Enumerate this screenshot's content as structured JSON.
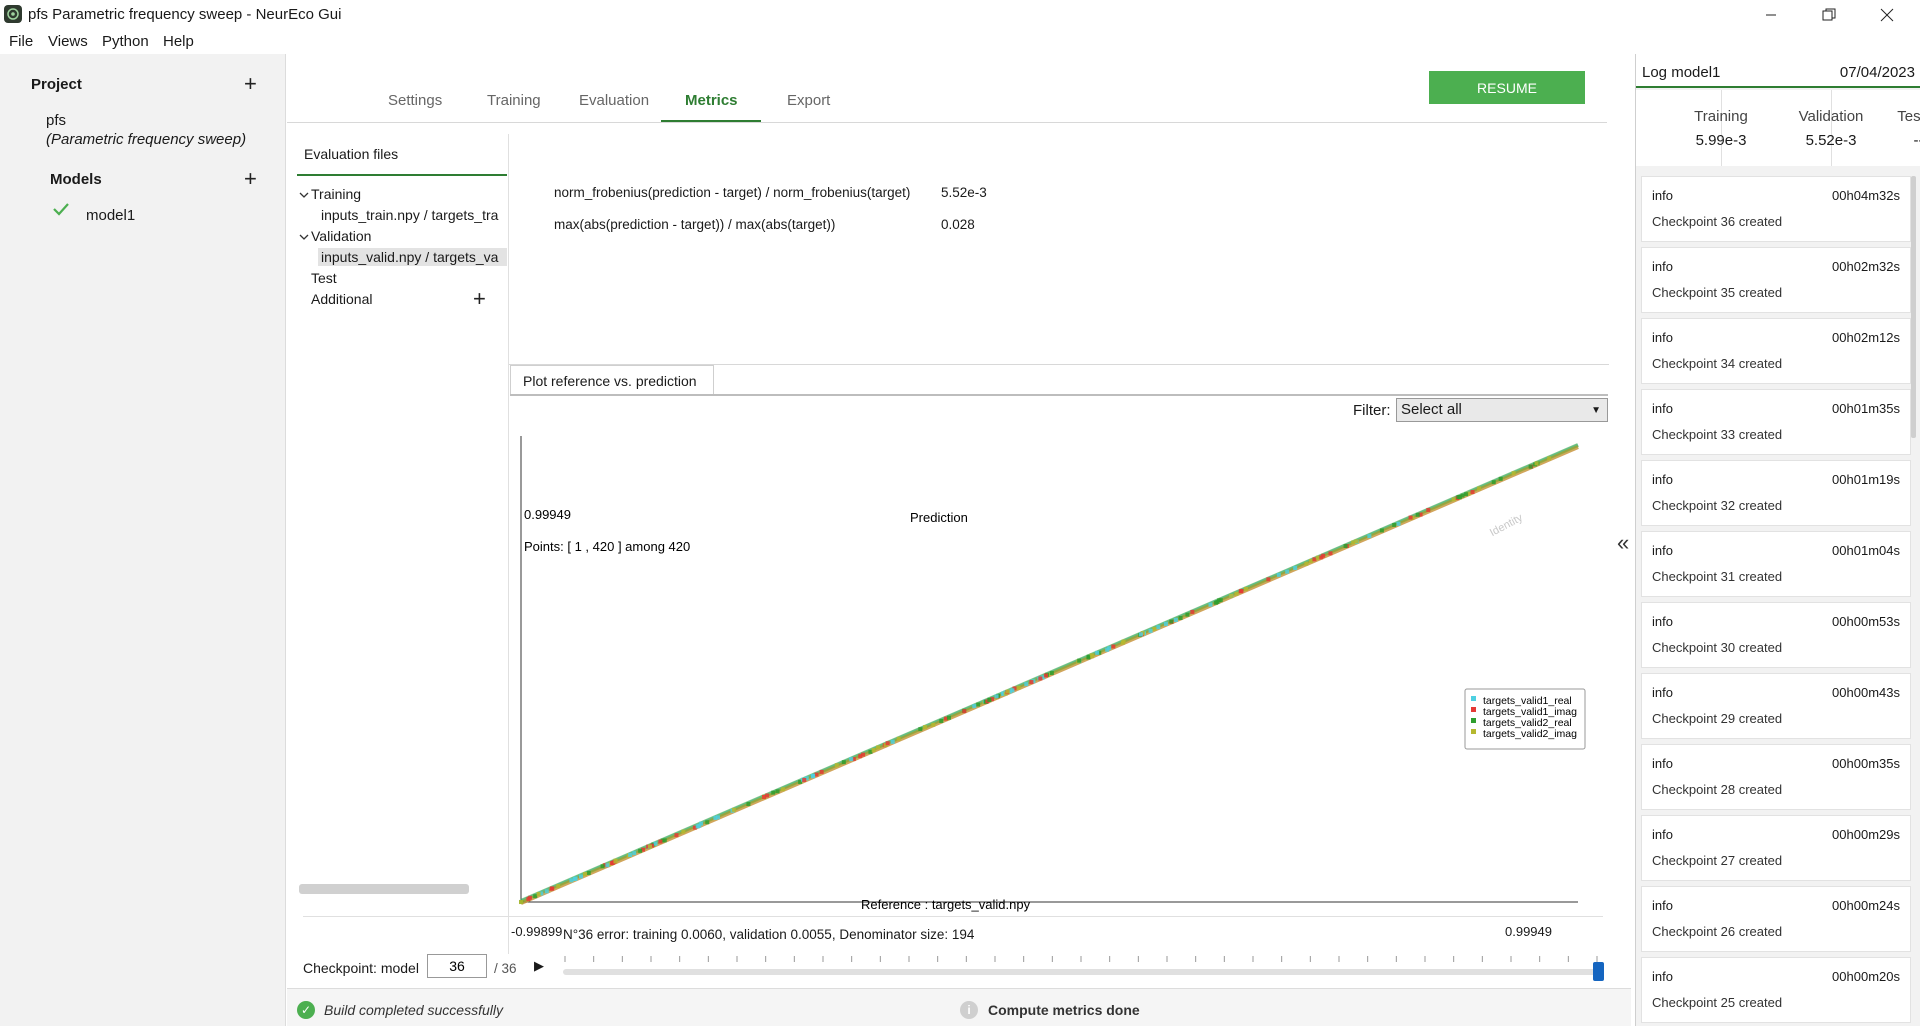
{
  "window": {
    "title": "pfs  Parametric frequency sweep  - NeurEco Gui"
  },
  "menu": [
    "File",
    "Views",
    "Python",
    "Help"
  ],
  "project": {
    "heading": "Project",
    "name": "pfs",
    "description": "(Parametric frequency sweep)",
    "models_heading": "Models",
    "models": [
      {
        "name": "model1",
        "status": "ok"
      }
    ]
  },
  "tabs": [
    "Settings",
    "Training",
    "Evaluation",
    "Metrics",
    "Export"
  ],
  "active_tab": "Metrics",
  "resume_label": "RESUME",
  "eval_files": {
    "label": "Evaluation files",
    "training": "Training",
    "training_file": "inputs_train.npy / targets_tra",
    "validation": "Validation",
    "validation_file": "inputs_valid.npy / targets_va",
    "test": "Test",
    "additional": "Additional"
  },
  "metrics": [
    {
      "name": "norm_frobenius(prediction - target) / norm_frobenius(target)",
      "value": "5.52e-3"
    },
    {
      "name": "max(abs(prediction - target)) / max(abs(target))",
      "value": "0.028"
    }
  ],
  "plot_tab": "Plot reference vs. prediction",
  "filter": {
    "label": "Filter:",
    "value": "Select all"
  },
  "colors": {
    "accent": "#2e7d32",
    "resume": "#4caf50",
    "series": [
      "#4dd0e1",
      "#e53935",
      "#2e9e2e",
      "#b5b82f"
    ]
  },
  "chart_data": {
    "type": "scatter",
    "title": "Prediction",
    "xlabel": "Reference : targets_valid.npy",
    "ymax_label": "0.99949",
    "xmin_label": "-0.99899",
    "xmax_label": "0.99949",
    "points_text": "Points: [ 1 , 420 ] among 420",
    "identity_label": "Identity",
    "xlim": [
      -0.99899,
      0.99949
    ],
    "ylim": [
      -0.99899,
      0.99949
    ],
    "series": [
      {
        "name": "targets_valid1_real"
      },
      {
        "name": "targets_valid1_imag"
      },
      {
        "name": "targets_valid2_real"
      },
      {
        "name": "targets_valid2_imag"
      }
    ],
    "legend_position": "bottom-right"
  },
  "error_text": "N°36 error: training 0.0060, validation 0.0055, Denominator size: 194",
  "checkpoint": {
    "label": "Checkpoint: model",
    "value": "36",
    "total": "/ 36",
    "position": 36,
    "max": 36
  },
  "status": {
    "build": "Build completed successfully",
    "compute": "Compute metrics done"
  },
  "log": {
    "title": "Log model1",
    "date": "07/04/2023",
    "metrics": [
      {
        "label": "Training",
        "value": "5.99e-3"
      },
      {
        "label": "Validation",
        "value": "5.52e-3"
      },
      {
        "label": "Testing",
        "value": "---"
      }
    ],
    "entries": [
      {
        "level": "info",
        "time": "00h04m32s",
        "message": "Checkpoint 36 created"
      },
      {
        "level": "info",
        "time": "00h02m32s",
        "message": "Checkpoint 35 created"
      },
      {
        "level": "info",
        "time": "00h02m12s",
        "message": "Checkpoint 34 created"
      },
      {
        "level": "info",
        "time": "00h01m35s",
        "message": "Checkpoint 33 created"
      },
      {
        "level": "info",
        "time": "00h01m19s",
        "message": "Checkpoint 32 created"
      },
      {
        "level": "info",
        "time": "00h01m04s",
        "message": "Checkpoint 31 created"
      },
      {
        "level": "info",
        "time": "00h00m53s",
        "message": "Checkpoint 30 created"
      },
      {
        "level": "info",
        "time": "00h00m43s",
        "message": "Checkpoint 29 created"
      },
      {
        "level": "info",
        "time": "00h00m35s",
        "message": "Checkpoint 28 created"
      },
      {
        "level": "info",
        "time": "00h00m29s",
        "message": "Checkpoint 27 created"
      },
      {
        "level": "info",
        "time": "00h00m24s",
        "message": "Checkpoint 26 created"
      },
      {
        "level": "info",
        "time": "00h00m20s",
        "message": "Checkpoint 25 created"
      }
    ]
  }
}
